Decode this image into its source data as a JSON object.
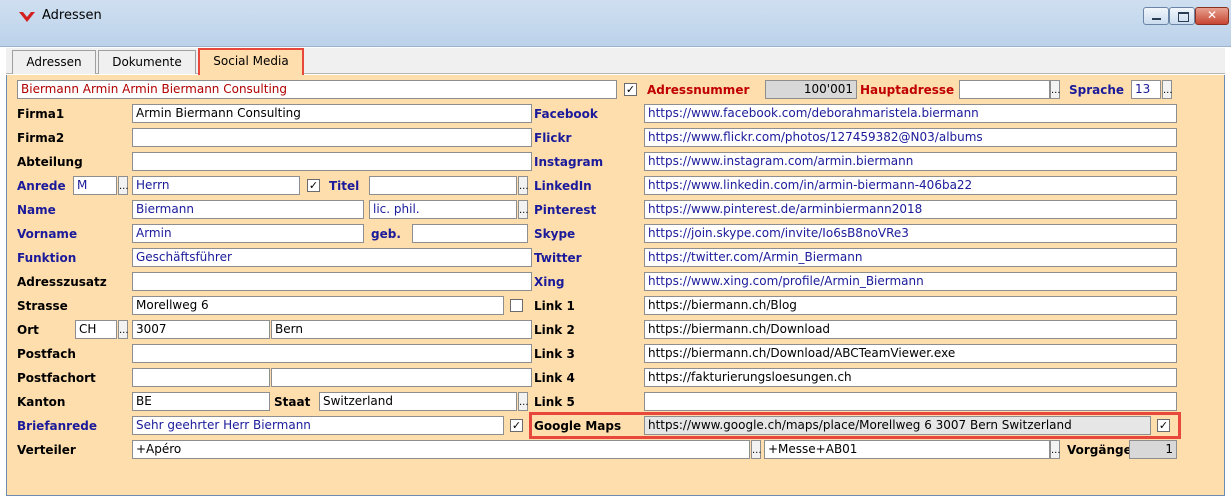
{
  "window": {
    "title": "Adressen"
  },
  "tabs": [
    "Adressen",
    "Dokumente",
    "Social Media"
  ],
  "header": {
    "name_display": "Biermann Armin Armin Biermann Consulting",
    "adressnummer_label": "Adressnummer",
    "adressnummer_value": "100'001",
    "hauptadresse_label": "Hauptadresse",
    "hauptadresse_value": "",
    "sprache_label": "Sprache",
    "sprache_value": "13"
  },
  "left": {
    "firma1_label": "Firma1",
    "firma1_value": "Armin Biermann Consulting",
    "firma2_label": "Firma2",
    "firma2_value": "",
    "abteilung_label": "Abteilung",
    "abteilung_value": "",
    "anrede_label": "Anrede",
    "anrede_code": "M",
    "anrede_value": "Herrn",
    "titel_label": "Titel",
    "titel_value": "",
    "name_label": "Name",
    "name_value": "Biermann",
    "name_suffix": "lic. phil.",
    "vorname_label": "Vorname",
    "vorname_value": "Armin",
    "geb_label": "geb.",
    "geb_value": "",
    "funktion_label": "Funktion",
    "funktion_value": "Geschäftsführer",
    "adresszusatz_label": "Adresszusatz",
    "adresszusatz_value": "",
    "strasse_label": "Strasse",
    "strasse_value": "Morellweg 6",
    "ort_label": "Ort",
    "ort_country": "CH",
    "ort_plz": "3007",
    "ort_value": "Bern",
    "postfach_label": "Postfach",
    "postfach_value": "",
    "postfachort_label": "Postfachort",
    "postfachort_plz": "",
    "postfachort_value": "",
    "kanton_label": "Kanton",
    "kanton_value": "BE",
    "staat_label": "Staat",
    "staat_value": "Switzerland",
    "briefanrede_label": "Briefanrede",
    "briefanrede_value": "Sehr geehrter Herr Biermann",
    "verteiler_label": "Verteiler",
    "verteiler_value": "+Apéro"
  },
  "social": {
    "facebook_label": "Facebook",
    "facebook_value": "https://www.facebook.com/deborahmaristela.biermann",
    "flickr_label": "Flickr",
    "flickr_value": "https://www.flickr.com/photos/127459382@N03/albums",
    "instagram_label": "Instagram",
    "instagram_value": "https://www.instagram.com/armin.biermann",
    "linkedin_label": "LinkedIn",
    "linkedin_value": "https://www.linkedin.com/in/armin-biermann-406ba22",
    "pinterest_label": "Pinterest",
    "pinterest_value": "https://www.pinterest.de/arminbiermann2018",
    "skype_label": "Skype",
    "skype_value": "https://join.skype.com/invite/Io6sB8noVRe3",
    "twitter_label": "Twitter",
    "twitter_value": "https://twitter.com/Armin_Biermann",
    "xing_label": "Xing",
    "xing_value": "https://www.xing.com/profile/Armin_Biermann",
    "link1_label": "Link 1",
    "link1_value": "https://biermann.ch/Blog",
    "link2_label": "Link 2",
    "link2_value": "https://biermann.ch/Download",
    "link3_label": "Link 3",
    "link3_value": "https://biermann.ch/Download/ABCTeamViewer.exe",
    "link4_label": "Link 4",
    "link4_value": "https://fakturierungsloesungen.ch",
    "link5_label": "Link 5",
    "link5_value": "",
    "googlemaps_label": "Google Maps",
    "googlemaps_value": "https://www.google.ch/maps/place/Morellweg 6 3007  Bern Switzerland",
    "messe_value": "+Messe+AB01",
    "vorgaenge_label": "Vorgänge",
    "vorgaenge_value": "1"
  },
  "glyphs": {
    "check": "✓",
    "lookup": "..."
  },
  "colors": {
    "form_bg": "#ffdead",
    "label_blue": "#1a1a9a",
    "highlight": "#e8483c"
  }
}
